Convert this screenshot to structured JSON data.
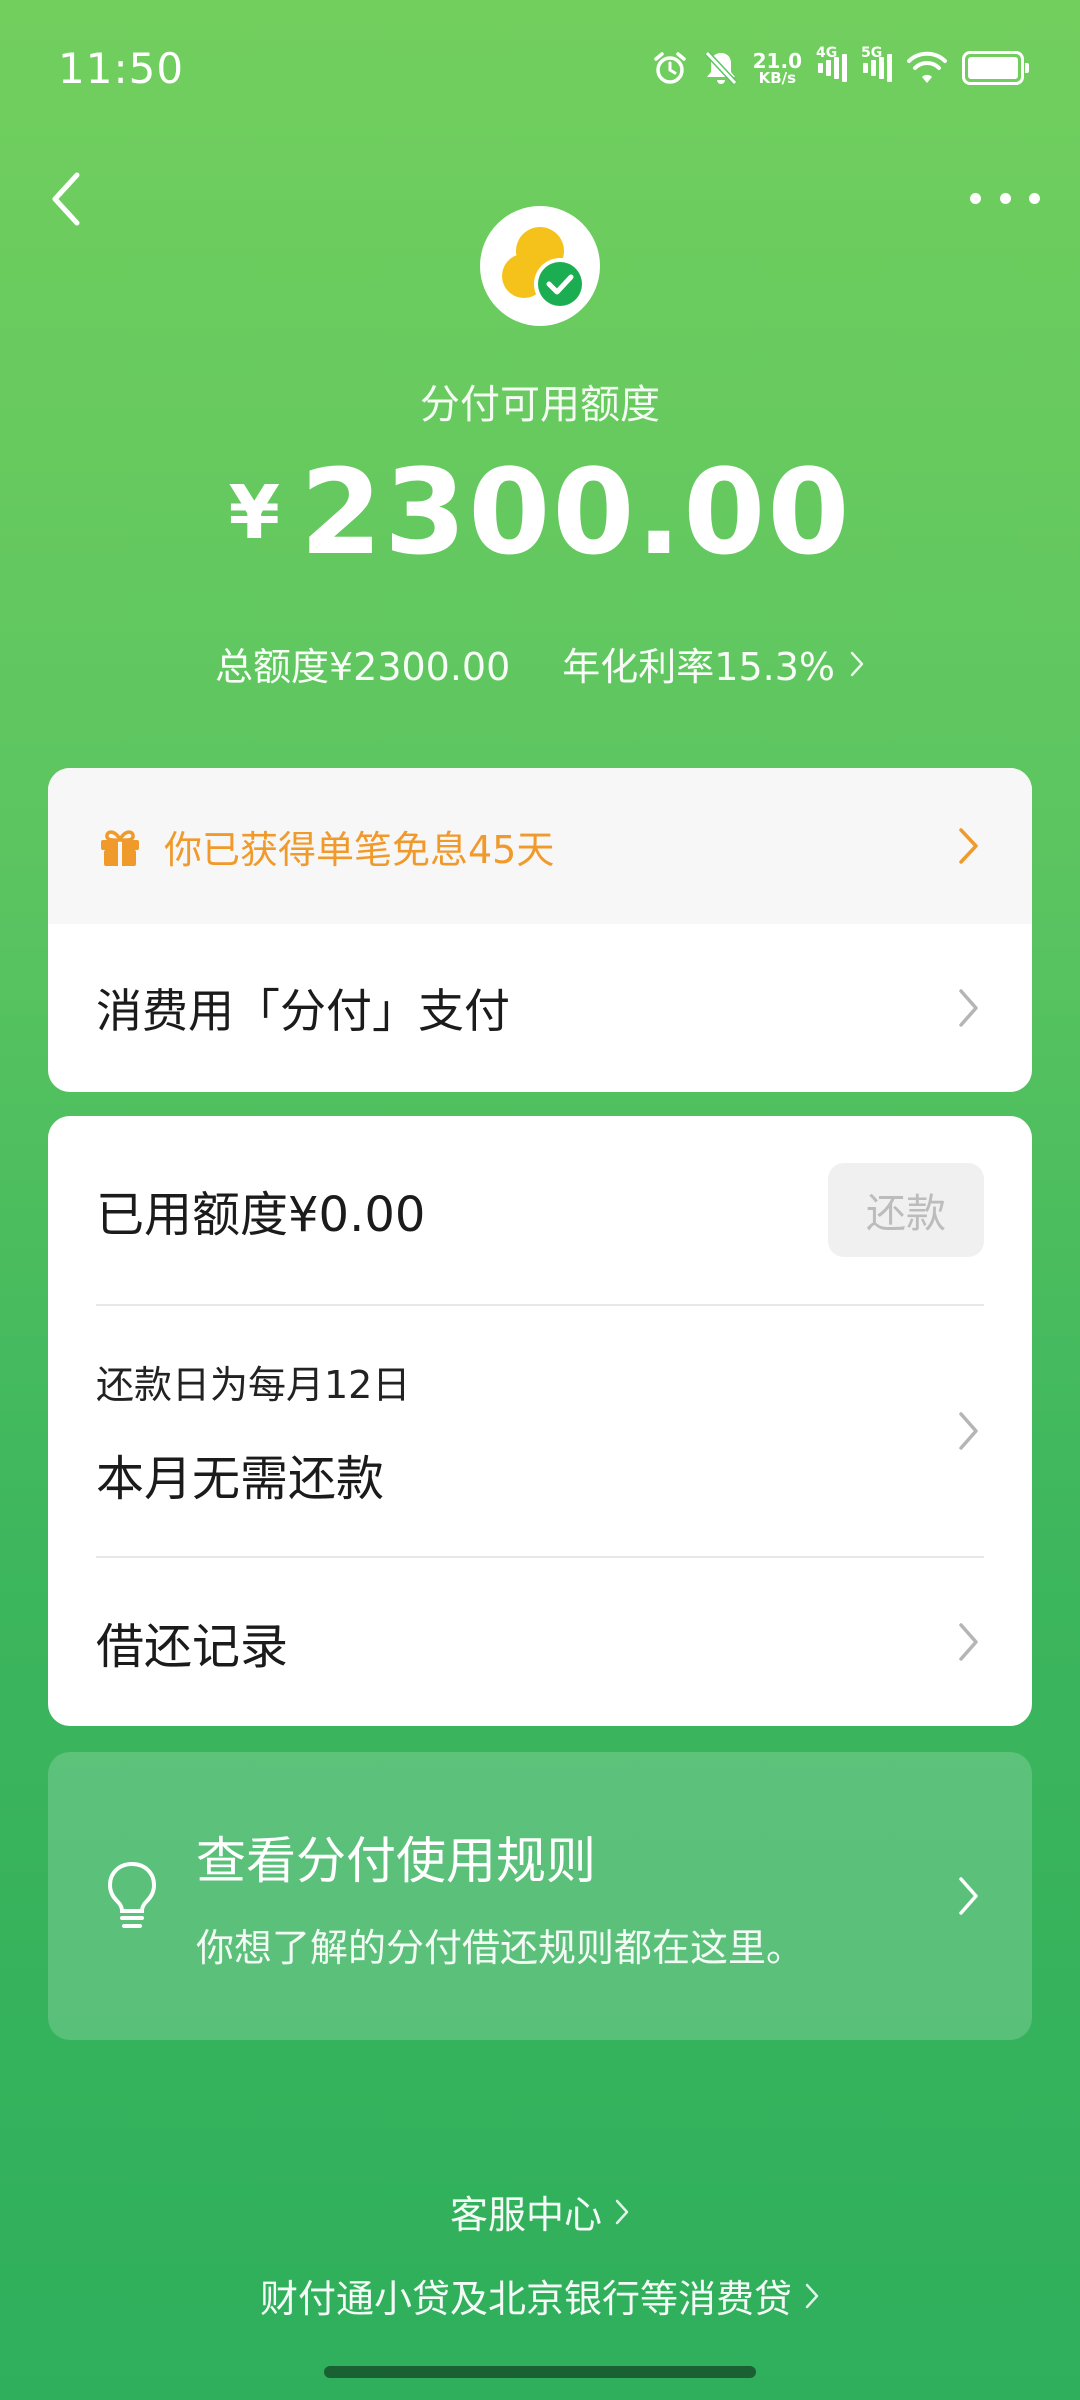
{
  "status_bar": {
    "time": "11:50",
    "net_speed_value": "21.0",
    "net_speed_unit": "KB/s",
    "signal1_tag": "4G",
    "signal2_tag": "5G",
    "battery_level": 1.0,
    "icons": [
      "alarm-icon",
      "mute-icon",
      "signal-icon",
      "wifi-icon",
      "battery-icon"
    ]
  },
  "header": {
    "available_label": "分付可用额度",
    "currency_symbol": "¥",
    "available_amount": "2300.00",
    "total_credit": "总额度¥2300.00",
    "annual_rate": "年化利率15.3%"
  },
  "promo": {
    "text": "你已获得单笔免息45天"
  },
  "pay_row": {
    "label": "消费用「分付」支付"
  },
  "used": {
    "label": "已用额度¥0.00",
    "repay_button": "还款"
  },
  "repayment": {
    "date_text": "还款日为每月12日",
    "status_text": "本月无需还款"
  },
  "records": {
    "label": "借还记录"
  },
  "rules": {
    "title": "查看分付使用规则",
    "description": "你想了解的分付借还规则都在这里。"
  },
  "footer": {
    "service_center": "客服中心",
    "lenders": "财付通小贷及北京银行等消费贷"
  },
  "colors": {
    "bg_top": "#72cf5e",
    "bg_bottom": "#2faf5c",
    "promo_orange": "#f19a2c",
    "logo_green": "#1aad52",
    "logo_yellow": "#f5c21b"
  }
}
